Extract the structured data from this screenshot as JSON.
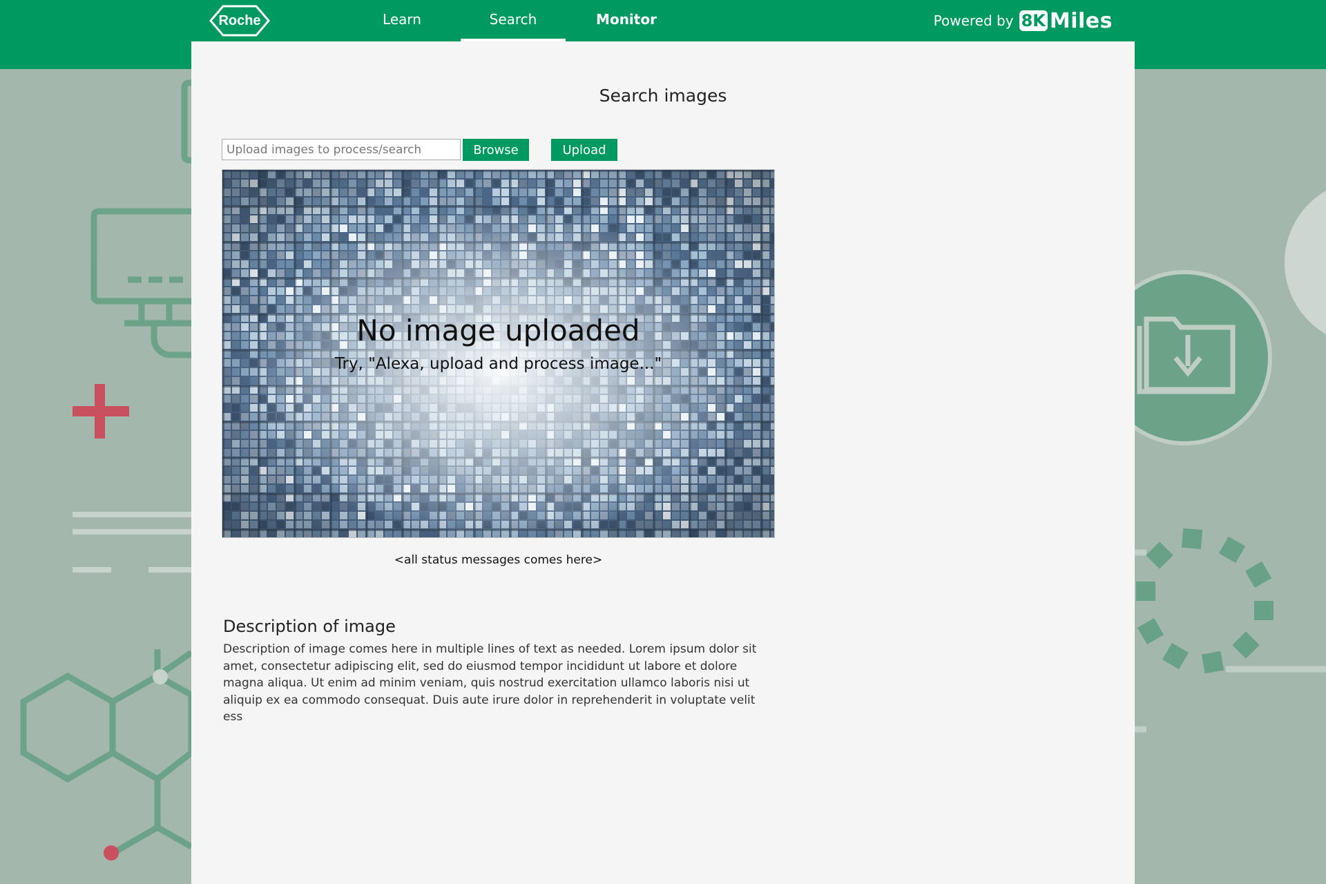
{
  "brand": {
    "logo_text": "Roche"
  },
  "nav": {
    "tabs": [
      {
        "label": "Learn"
      },
      {
        "label": "Search"
      },
      {
        "label": "Monitor"
      }
    ]
  },
  "powered": {
    "text": "Powered by",
    "brand_box": "8K",
    "brand_name": "Miles"
  },
  "page": {
    "title": "Search images"
  },
  "upload": {
    "placeholder": "Upload images to process/search",
    "browse_label": "Browse",
    "upload_label": "Upload"
  },
  "preview": {
    "title": "No image uploaded",
    "hint": "Try, \"Alexa, upload and process image...\""
  },
  "status": {
    "message": "<all status messages comes here>"
  },
  "description": {
    "title": "Description of image",
    "body": "Description of image comes here in multiple lines of text as needed. Lorem ipsum dolor sit amet, consectetur adipiscing elit, sed do eiusmod tempor incididunt ut labore et dolore magna aliqua. Ut enim ad minim veniam, quis nostrud exercitation ullamco laboris nisi ut aliquip ex ea commodo consequat. Duis aute irure dolor in reprehenderit in voluptate velit ess"
  },
  "colors": {
    "accent": "#009a61",
    "background": "#a4b7ad",
    "panel": "#f5f5f5",
    "decor_green": "#5f9e80",
    "decor_red": "#c8505f"
  },
  "icons": {
    "background_left": [
      "monitor-icon",
      "plus-icon",
      "molecule-icon"
    ],
    "background_right": [
      "folder-download-icon",
      "loading-ring-icon"
    ]
  }
}
